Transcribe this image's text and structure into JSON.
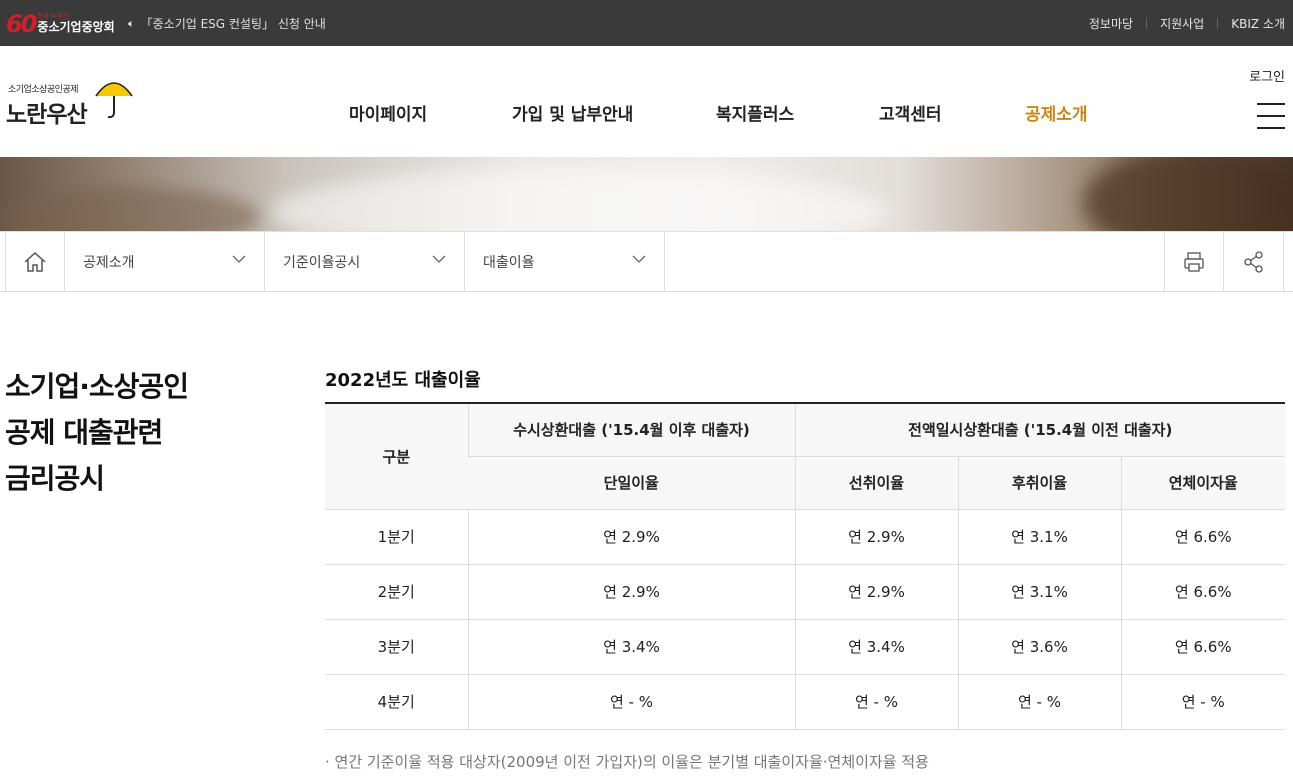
{
  "topbar": {
    "brand_badge": "60",
    "brand_small": "함께 60주년",
    "brand_name": "중소기업중앙회",
    "notice": "「중소기업 ESG 컨설팅」 신청 안내",
    "links": [
      "정보마당",
      "지원사업",
      "KBIZ 소개"
    ]
  },
  "header": {
    "logo_sub": "소기업소상공인공제",
    "logo_main": "노란우산",
    "nav": [
      "마이페이지",
      "가입 및 납부안내",
      "복지플러스",
      "고객센터",
      "공제소개"
    ],
    "active_nav": "공제소개",
    "login": "로그인",
    "accent_color": "#c8861a"
  },
  "location": {
    "depth1": "공제소개",
    "depth2": "기준이율공시",
    "depth3": "대출이율"
  },
  "page": {
    "title_lines": [
      "소기업·소상공인",
      "공제 대출관련",
      "금리공시"
    ],
    "table_title": "2022년도 대출이율",
    "headers": {
      "category": "구분",
      "group1": "수시상환대출 ('15.4월 이후 대출자)",
      "group2": "전액일시상환대출 ('15.4월 이전 대출자)",
      "single_rate": "단일이율",
      "prepaid_rate": "선취이율",
      "postpaid_rate": "후취이율",
      "overdue_rate": "연체이자율"
    },
    "rows": [
      {
        "quarter": "1분기",
        "single": "연 2.9%",
        "prepaid": "연 2.9%",
        "postpaid": "연 3.1%",
        "overdue": "연 6.6%"
      },
      {
        "quarter": "2분기",
        "single": "연 2.9%",
        "prepaid": "연 2.9%",
        "postpaid": "연 3.1%",
        "overdue": "연 6.6%"
      },
      {
        "quarter": "3분기",
        "single": "연 3.4%",
        "prepaid": "연 3.4%",
        "postpaid": "연 3.6%",
        "overdue": "연 6.6%"
      },
      {
        "quarter": "4분기",
        "single": "연 - %",
        "prepaid": "연 - %",
        "postpaid": "연 - %",
        "overdue": "연 - %"
      }
    ],
    "note": "· 연간 기준이율 적용 대상자(2009년 이전 가입자)의 이율은 분기별 대출이자율·연체이자율 적용"
  }
}
